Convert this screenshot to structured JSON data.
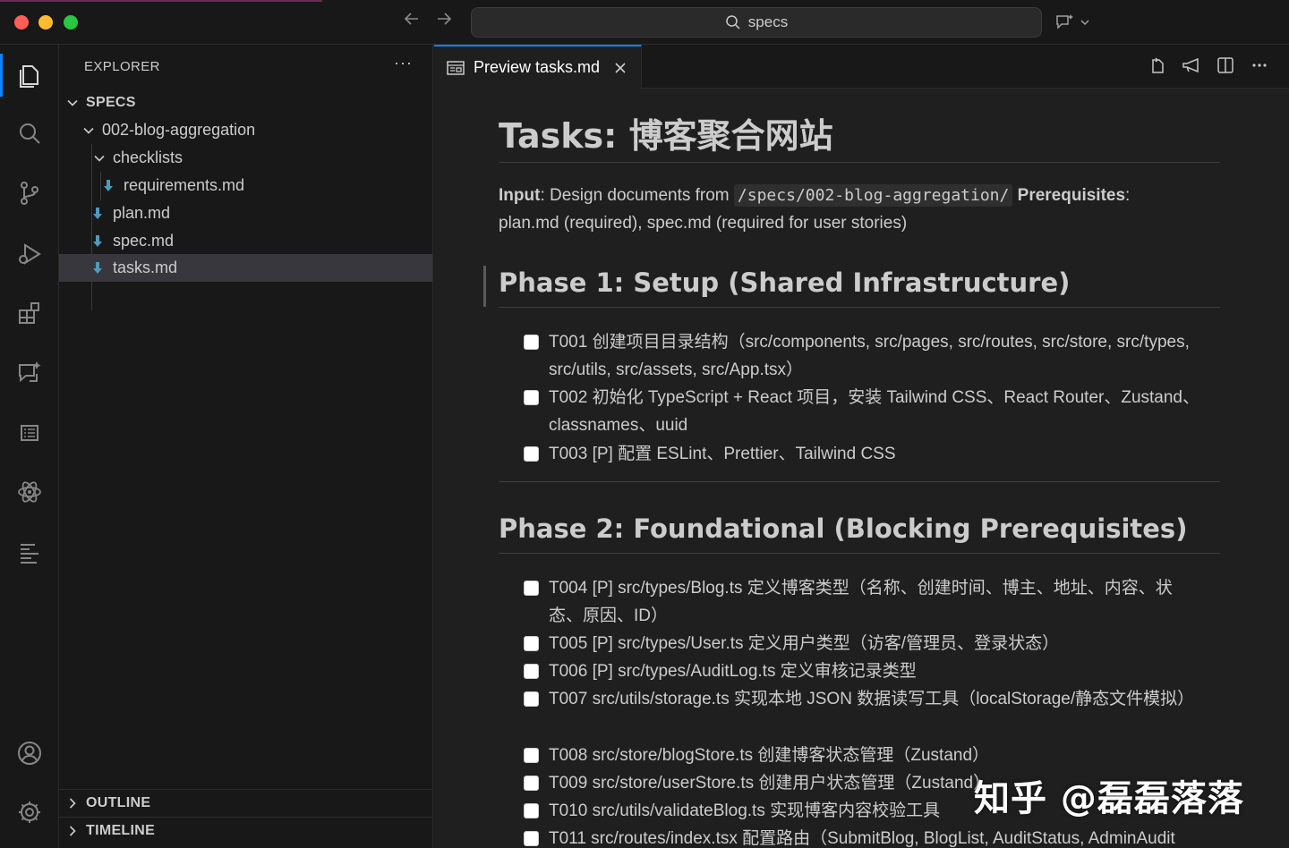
{
  "titlebar": {
    "search_text": "specs"
  },
  "activity_bar": {
    "items": [
      "explorer-icon",
      "search-icon",
      "source-control-icon",
      "run-debug-icon",
      "extensions-icon",
      "chat-icon",
      "outline-icon",
      "react-icon",
      "tasks-list-icon",
      "account-icon",
      "settings-gear-icon"
    ]
  },
  "explorer": {
    "header": "EXPLORER",
    "more": "···",
    "root": "SPECS",
    "tree": [
      {
        "label": "002-blog-aggregation",
        "type": "folder"
      },
      {
        "label": "checklists",
        "type": "folder"
      },
      {
        "label": "requirements.md",
        "type": "file"
      },
      {
        "label": "plan.md",
        "type": "file"
      },
      {
        "label": "spec.md",
        "type": "file"
      },
      {
        "label": "tasks.md",
        "type": "file",
        "selected": true
      }
    ],
    "outline": "OUTLINE",
    "timeline": "TIMELINE"
  },
  "tab": {
    "label": "Preview tasks.md"
  },
  "document": {
    "title": "Tasks: 博客聚合网站",
    "input_label": "Input",
    "input_text": ": Design documents from ",
    "input_path": "/specs/002-blog-aggregation/",
    "prereq_label": "Prerequisites",
    "prereq_text": ":",
    "prereq_line2": "plan.md (required), spec.md (required for user stories)",
    "phase1_title": "Phase 1: Setup (Shared Infrastructure)",
    "phase1_tasks": [
      "T001 创建项目目录结构（src/components, src/pages, src/routes, src/store, src/types, src/utils, src/assets, src/App.tsx）",
      "T002 初始化 TypeScript + React 项目，安装 Tailwind CSS、React Router、Zustand、classnames、uuid",
      "T003 [P] 配置 ESLint、Prettier、Tailwind CSS"
    ],
    "phase2_title": "Phase 2: Foundational (Blocking Prerequisites)",
    "phase2_tasks": [
      "T004 [P] src/types/Blog.ts 定义博客类型（名称、创建时间、博主、地址、内容、状态、原因、ID）",
      "T005 [P] src/types/User.ts 定义用户类型（访客/管理员、登录状态）",
      "T006 [P] src/types/AuditLog.ts 定义审核记录类型",
      "T007 src/utils/storage.ts 实现本地 JSON 数据读写工具（localStorage/静态文件模拟）",
      "T008 src/store/blogStore.ts 创建博客状态管理（Zustand）",
      "T009 src/store/userStore.ts 创建用户状态管理（Zustand）",
      "T010 src/utils/validateBlog.ts 实现博客内容校验工具",
      "T011 src/routes/index.tsx 配置路由（SubmitBlog, BlogList, AuditStatus, AdminAudit"
    ]
  },
  "watermark": "知乎 @磊磊落落"
}
